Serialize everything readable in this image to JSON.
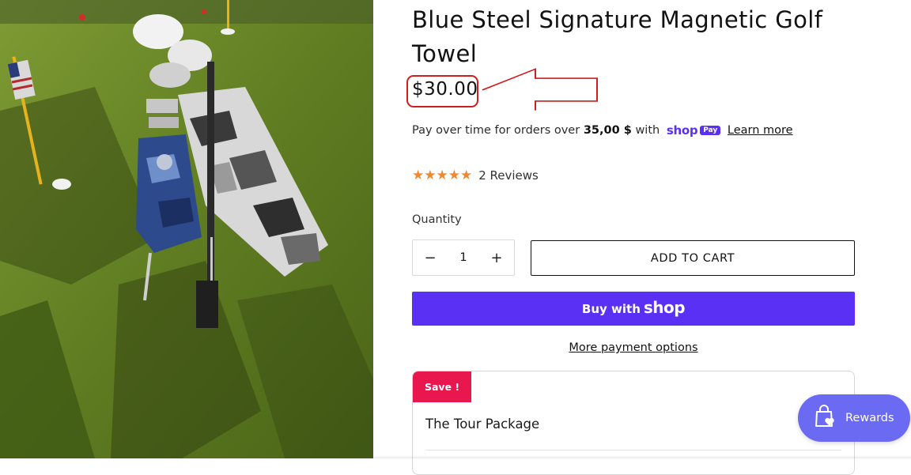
{
  "product": {
    "title": "Blue Steel Signature Magnetic Golf Towel",
    "price": "$30.00",
    "installments": {
      "prefix": "Pay over time for orders over",
      "threshold": "35,00 $",
      "with_text": "with",
      "shop_word": "shop",
      "pay_chip": "Pay",
      "learn_more": "Learn more"
    },
    "rating": {
      "stars": "★★★★★",
      "value": 5,
      "reviews_label": "2 Reviews"
    },
    "quantity": {
      "label": "Quantity",
      "minus": "−",
      "value": "1",
      "plus": "+"
    },
    "add_to_cart": "ADD TO CART",
    "buy_with": {
      "prefix": "Buy with",
      "brand": "shop"
    },
    "more_payment_options": "More payment options",
    "bundle": {
      "badge": "Save !",
      "title": "The Tour Package"
    }
  },
  "rewards": {
    "label": "Rewards"
  },
  "colors": {
    "shop_purple": "#5a31f4",
    "star_orange": "#f0892e",
    "save_red": "#e8174d",
    "rewards_blue": "#6a6af2",
    "annotation_red": "#cc1f1f"
  },
  "icons": {
    "rewards": "shopping-bag-heart-icon",
    "annotation": "red-arrow-pointing-left"
  }
}
